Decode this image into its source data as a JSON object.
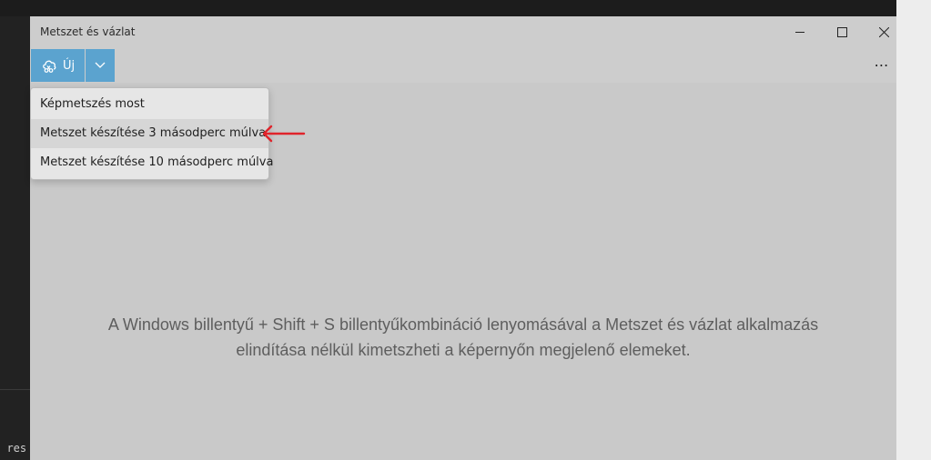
{
  "window": {
    "title": "Metszet és vázlat"
  },
  "toolbar": {
    "new_label": "Új",
    "new_icon": "snip-cloud-icon",
    "dropdown_icon": "chevron-down-icon",
    "more_label": "⋯"
  },
  "menu": {
    "items": [
      {
        "label": "Képmetszés most"
      },
      {
        "label": "Metszet készítése 3 másodperc múlva"
      },
      {
        "label": "Metszet készítése 10 másodperc múlva"
      }
    ]
  },
  "hint": {
    "line1": "A Windows billentyű + Shift + S billentyűkombináció lenyomásával a Metszet és vázlat alkalmazás",
    "line2": "elindítása nélkül kimetszheti a képernyőn megjelenő elemeket."
  },
  "background": {
    "terminal_fragment": "s res"
  },
  "colors": {
    "accent": "#5ba3cf",
    "annotation_arrow": "#e0242b"
  }
}
